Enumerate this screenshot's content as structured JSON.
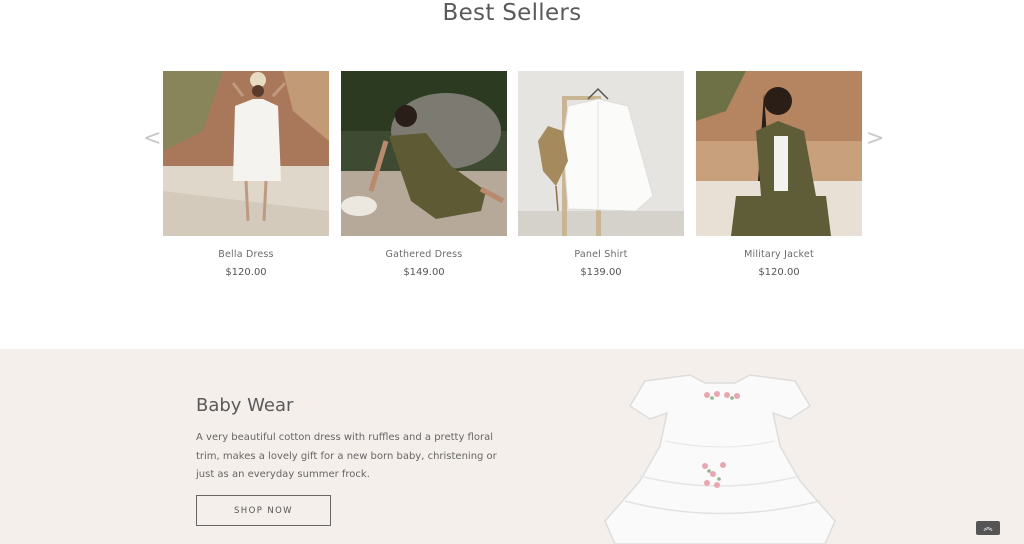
{
  "section": {
    "title": "Best Sellers"
  },
  "carousel": {
    "prev_label": "<",
    "next_label": ">"
  },
  "products": [
    {
      "name": "Bella Dress",
      "price": "$120.00",
      "image_icon": "white-dress-photo"
    },
    {
      "name": "Gathered Dress",
      "price": "$149.00",
      "image_icon": "olive-dress-photo"
    },
    {
      "name": "Panel Shirt",
      "price": "$139.00",
      "image_icon": "white-shirt-photo"
    },
    {
      "name": "Military Jacket",
      "price": "$120.00",
      "image_icon": "military-jacket-photo"
    }
  ],
  "promo": {
    "heading": "Baby Wear",
    "text": "A very beautiful cotton dress with ruffles and a pretty floral trim, makes a lovely gift for a new born baby, christening or just as an everyday summer frock.",
    "button_label": "SHOP NOW",
    "image_icon": "baby-dress-photo",
    "background": "#f4efeb"
  },
  "scroll_top": {
    "label": "︽",
    "icon": "double-chevron-up-icon"
  }
}
